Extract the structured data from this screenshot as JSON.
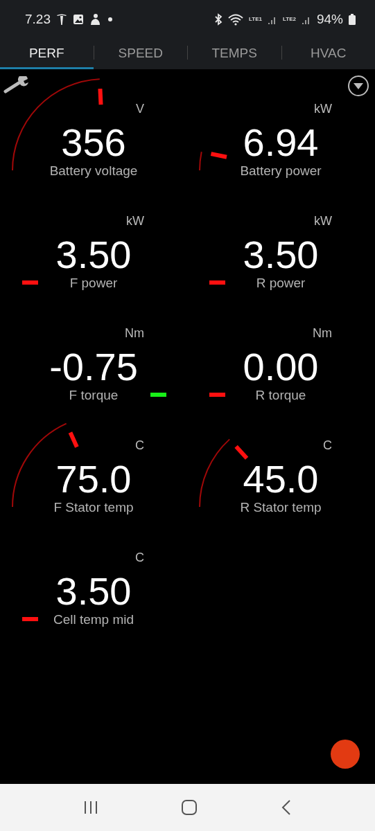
{
  "status_bar": {
    "time": "7.23",
    "battery": "94%",
    "sim_labels": [
      "LTE1",
      "LTE2"
    ]
  },
  "tabs": [
    {
      "label": "PERF",
      "selected": true
    },
    {
      "label": "SPEED",
      "selected": false
    },
    {
      "label": "TEMPS",
      "selected": false
    },
    {
      "label": "HVAC",
      "selected": false
    }
  ],
  "gauges": [
    {
      "value": "356",
      "label": "Battery voltage",
      "unit": "V",
      "color": "#ff1010",
      "kind": "normal"
    },
    {
      "value": "6.94",
      "label": "Battery power",
      "unit": "kW",
      "color": "#ff1010",
      "kind": "normal"
    },
    {
      "value": "3.50",
      "label": "F power",
      "unit": "kW",
      "color": "#ff1010",
      "kind": "normal"
    },
    {
      "value": "3.50",
      "label": "R power",
      "unit": "kW",
      "color": "#ff1010",
      "kind": "normal"
    },
    {
      "value": "-0.75",
      "label": "F torque",
      "unit": "Nm",
      "color": "#18f018",
      "kind": "reverse"
    },
    {
      "value": "0.00",
      "label": "R torque",
      "unit": "Nm",
      "color": "#ff1010",
      "kind": "normal"
    },
    {
      "value": "75.0",
      "label": "F Stator temp",
      "unit": "C",
      "color": "#ff1010",
      "kind": "normal"
    },
    {
      "value": "45.0",
      "label": "R Stator temp",
      "unit": "C",
      "color": "#ff1010",
      "kind": "normal"
    },
    {
      "value": "3.50",
      "label": "Cell temp mid",
      "unit": "C",
      "color": "#ff1010",
      "kind": "normal"
    }
  ]
}
